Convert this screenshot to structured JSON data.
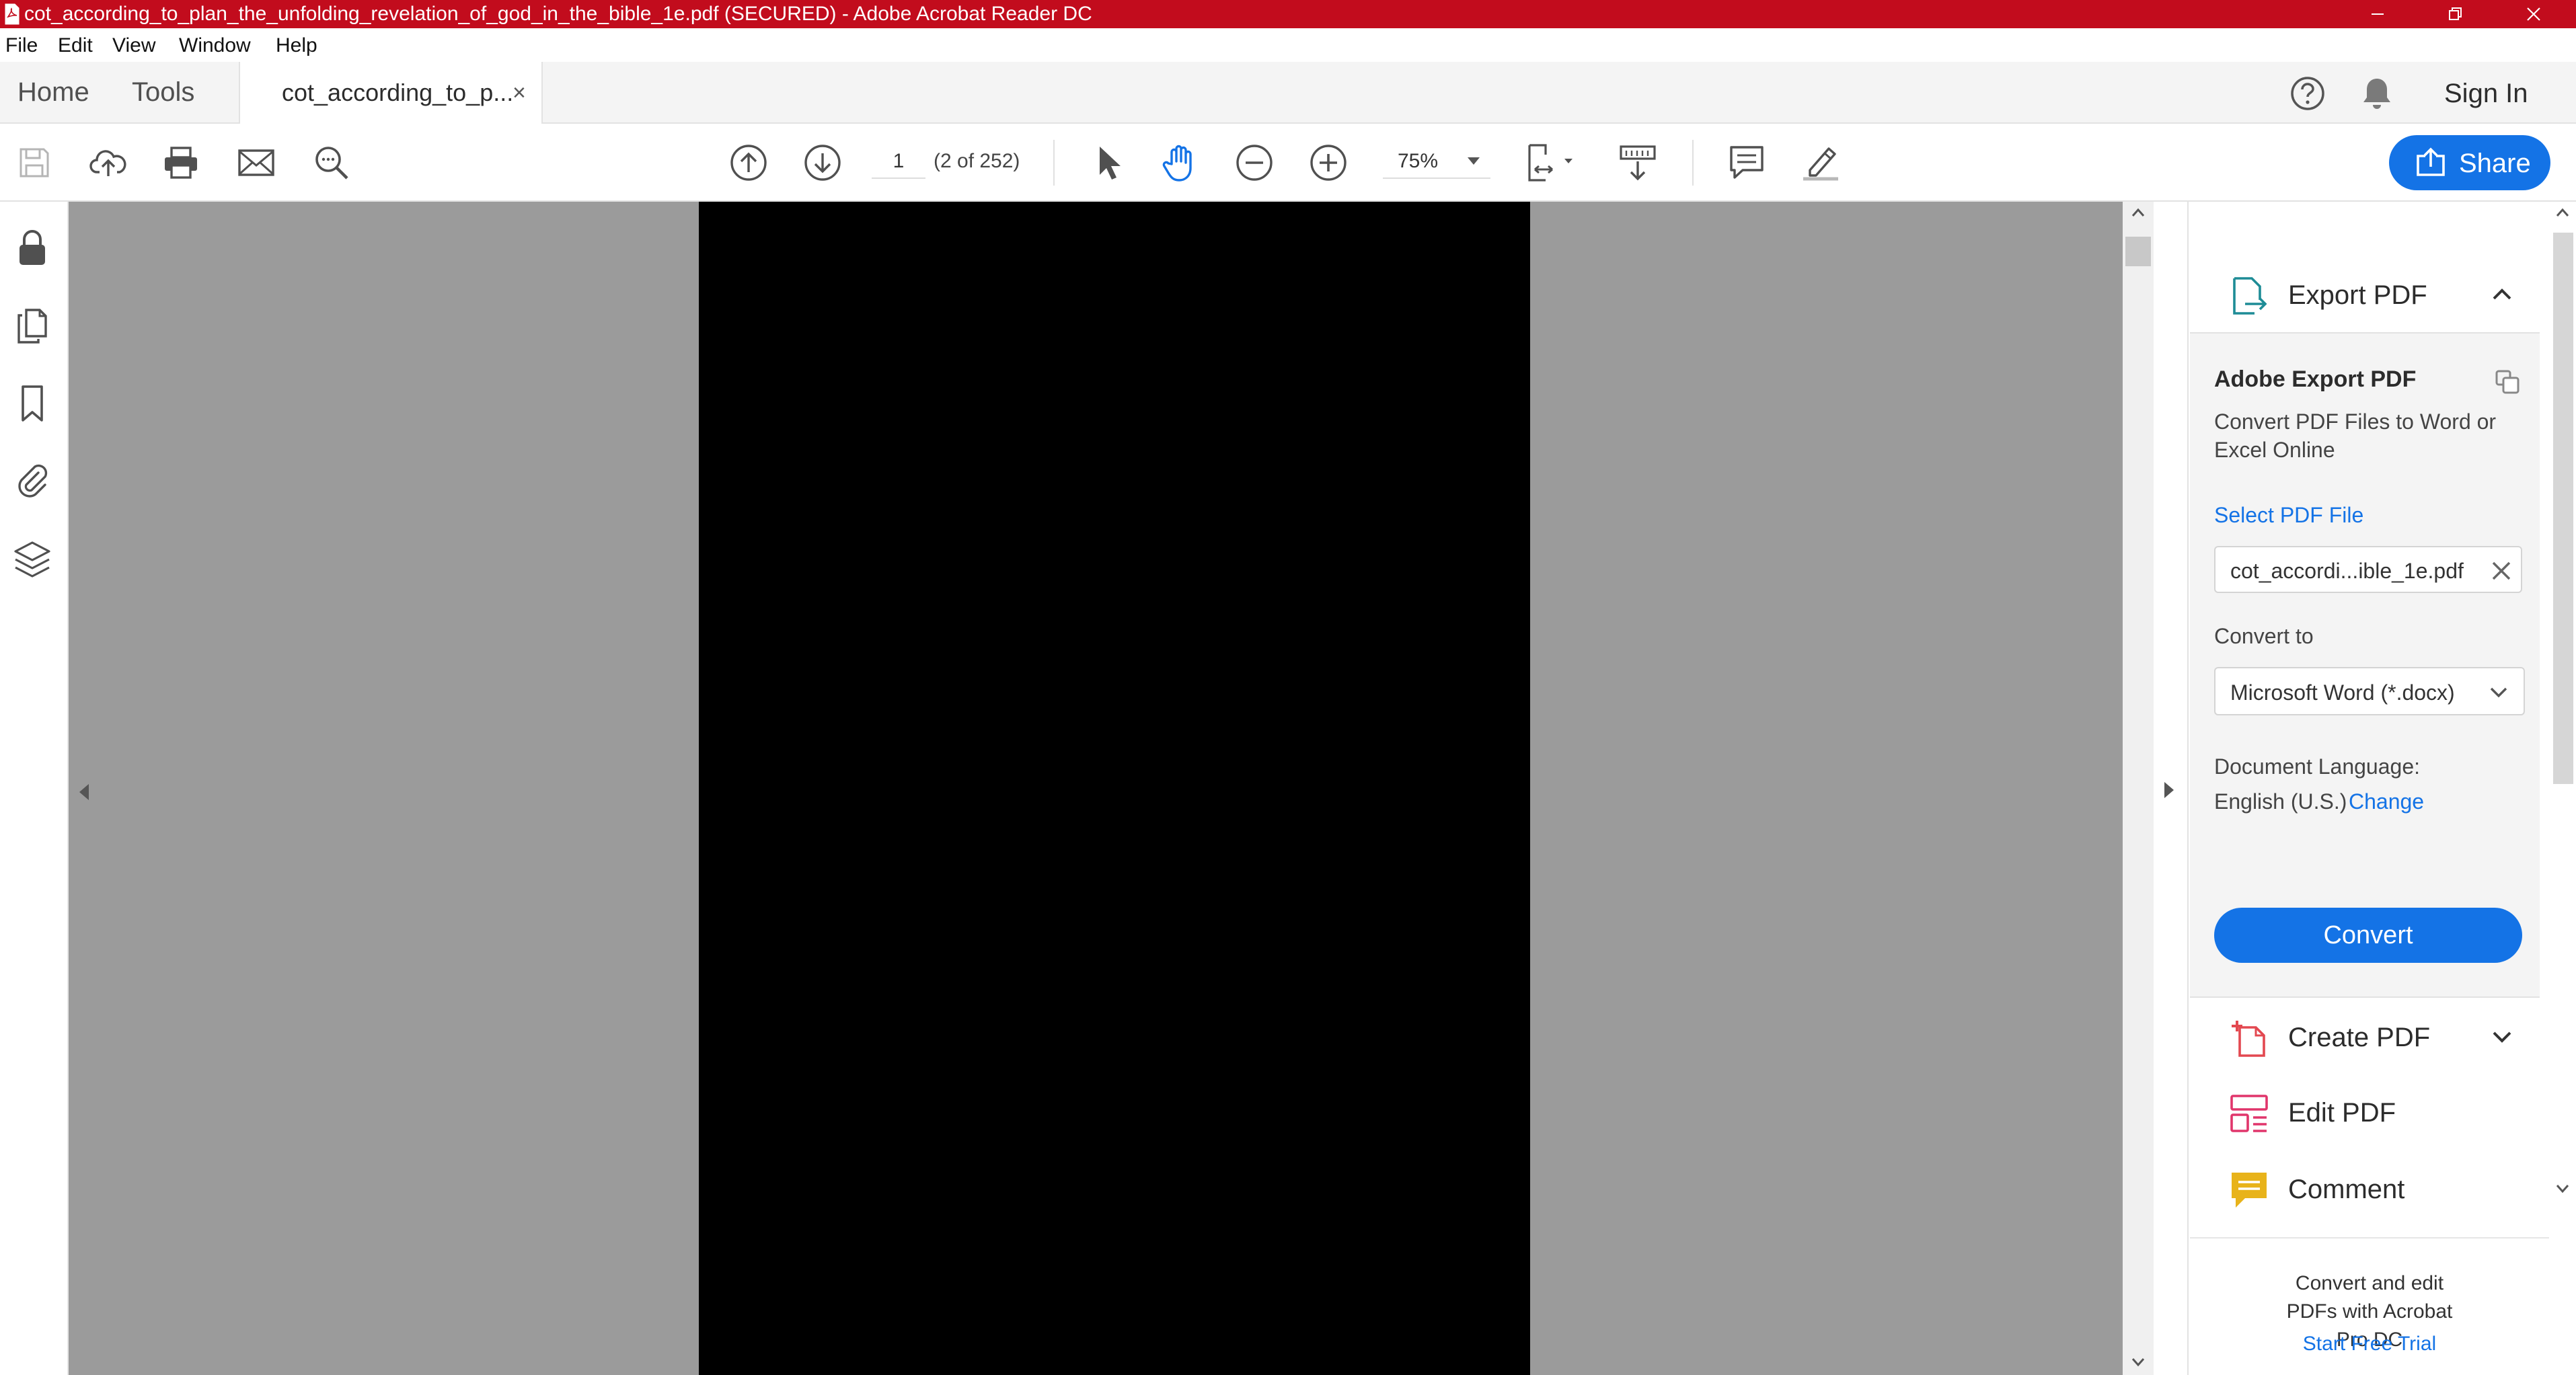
{
  "window": {
    "title": "cot_according_to_plan_the_unfolding_revelation_of_god_in_the_bible_1e.pdf (SECURED) - Adobe Acrobat Reader DC",
    "title_bar_color": "#c20c1d"
  },
  "menu": [
    "File",
    "Edit",
    "View",
    "Window",
    "Help"
  ],
  "tabs": {
    "home": "Home",
    "tools": "Tools",
    "document": "cot_according_to_p...",
    "close_glyph": "×"
  },
  "header": {
    "sign_in": "Sign In"
  },
  "toolbar": {
    "page_number": "1",
    "page_of": "(2 of 252)",
    "zoom": "75%",
    "share_label": "Share",
    "accent": "#1473e6"
  },
  "icons": {
    "toolbar": [
      "save-icon",
      "upload-cloud-icon",
      "print-icon",
      "email-icon",
      "search-zoom-icon",
      "page-up-icon",
      "page-down-icon",
      "select-cursor-icon",
      "hand-tool-icon",
      "zoom-out-icon",
      "zoom-in-icon",
      "fit-page-icon",
      "scrolling-mode-icon",
      "comment-icon",
      "highlight-pen-icon"
    ],
    "sidebar": [
      "lock-icon",
      "pages-icon",
      "bookmark-icon",
      "attachment-icon",
      "layers-icon"
    ]
  },
  "right_panel": {
    "export_pdf": {
      "label": "Export PDF",
      "title": "Adobe Export PDF",
      "description": "Convert PDF Files to Word or Excel Online",
      "select_link": "Select PDF File",
      "file_name": "cot_accordi...ible_1e.pdf",
      "convert_to_label": "Convert to",
      "format": "Microsoft Word (*.docx)",
      "language_label": "Document Language:",
      "language_value": "English (U.S.)",
      "language_change": "Change",
      "convert_button": "Convert"
    },
    "tools": [
      {
        "label": "Create PDF",
        "color": "#e34850"
      },
      {
        "label": "Edit PDF",
        "color": "#e0356b"
      },
      {
        "label": "Comment",
        "color": "#e8b31a"
      }
    ],
    "upsell": {
      "text": "Convert and edit PDFs with Acrobat Pro DC",
      "link": "Start Free Trial"
    }
  }
}
